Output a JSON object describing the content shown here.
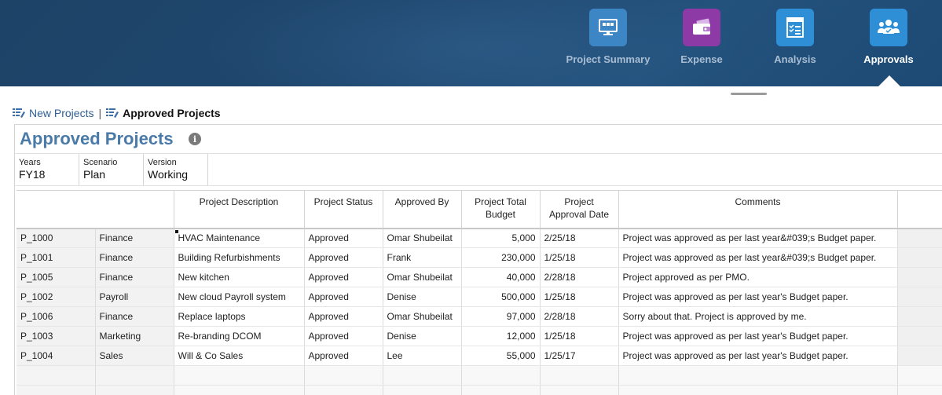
{
  "nav": {
    "items": [
      {
        "label": "Project Summary",
        "icon": "monitor-icon",
        "color": "#3d86c6"
      },
      {
        "label": "Expense",
        "icon": "wallet-icon",
        "color": "#8e3aa6"
      },
      {
        "label": "Analysis",
        "icon": "checklist-icon",
        "color": "#2e8fd6"
      },
      {
        "label": "Approvals",
        "icon": "group-icon",
        "color": "#2e8fd6"
      }
    ],
    "active": "Approvals"
  },
  "breadcrumb": {
    "items": [
      {
        "label": "New Projects",
        "icon": "form-icon"
      },
      {
        "label": "Approved Projects",
        "icon": "form-icon"
      }
    ],
    "separator": "|"
  },
  "form": {
    "title": "Approved Projects",
    "info_icon": "i",
    "pov": [
      {
        "label": "Years",
        "value": "FY18"
      },
      {
        "label": "Scenario",
        "value": "Plan"
      },
      {
        "label": "Version",
        "value": "Working"
      }
    ]
  },
  "grid": {
    "headers": {
      "description": "Project Description",
      "status": "Project Status",
      "approved_by": "Approved By",
      "budget_line1": "Project Total",
      "budget_line2": "Budget",
      "approval_line1": "Project",
      "approval_line2": "Approval Date",
      "comments": "Comments"
    },
    "rows": [
      {
        "project": "P_1000",
        "dept": "Finance",
        "description": "HVAC Maintenance",
        "status": "Approved",
        "approved_by": "Omar Shubeilat",
        "budget": "5,000",
        "date": "2/25/18",
        "comment": "Project was approved as per last year&#039;s Budget paper."
      },
      {
        "project": "P_1001",
        "dept": "Finance",
        "description": "Building Refurbishments",
        "status": "Approved",
        "approved_by": "Frank",
        "budget": "230,000",
        "date": "1/25/18",
        "comment": "Project was approved as per last year&#039;s Budget paper."
      },
      {
        "project": "P_1005",
        "dept": "Finance",
        "description": "New kitchen",
        "status": "Approved",
        "approved_by": "Omar Shubeilat",
        "budget": "40,000",
        "date": "2/28/18",
        "comment": "Project approved as per PMO."
      },
      {
        "project": "P_1002",
        "dept": "Payroll",
        "description": "New cloud Payroll system",
        "status": "Approved",
        "approved_by": "Denise",
        "budget": "500,000",
        "date": "1/25/18",
        "comment": "Project was approved as per last year's Budget paper."
      },
      {
        "project": "P_1006",
        "dept": "Finance",
        "description": "Replace laptops",
        "status": "Approved",
        "approved_by": "Omar Shubeilat",
        "budget": "97,000",
        "date": "2/28/18",
        "comment": "Sorry about that. Project is approved by me."
      },
      {
        "project": "P_1003",
        "dept": "Marketing",
        "description": "Re-branding DCOM",
        "status": "Approved",
        "approved_by": "Denise",
        "budget": "12,000",
        "date": "1/25/18",
        "comment": "Project was approved as per last year's Budget paper."
      },
      {
        "project": "P_1004",
        "dept": "Sales",
        "description": "Will & Co Sales",
        "status": "Approved",
        "approved_by": "Lee",
        "budget": "55,000",
        "date": "1/25/17",
        "comment": "Project was approved as per last year's Budget paper."
      }
    ]
  }
}
